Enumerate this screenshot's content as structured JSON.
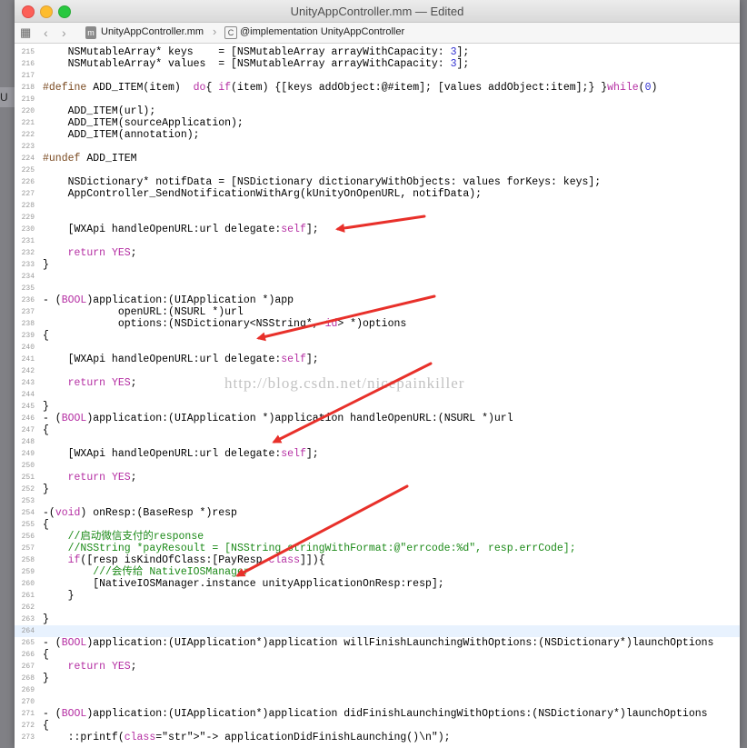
{
  "window": {
    "title": "UnityAppController.mm — Edited"
  },
  "jumpbar": {
    "file_icon_label": "m",
    "file": "UnityAppController.mm",
    "class_icon_label": "C",
    "implementation": "@implementation UnityAppController"
  },
  "background_app_label": "U",
  "watermark": "http://blog.csdn.net/nicepainkiller",
  "lines": [
    {
      "n": "215",
      "t": "    NSMutableArray* keys    = [NSMutableArray arrayWithCapacity: 3];"
    },
    {
      "n": "216",
      "t": "    NSMutableArray* values  = [NSMutableArray arrayWithCapacity: 3];"
    },
    {
      "n": "217",
      "t": ""
    },
    {
      "n": "218",
      "t": "#define ADD_ITEM(item)  do{ if(item) {[keys addObject:@#item]; [values addObject:item];} }while(0)"
    },
    {
      "n": "219",
      "t": ""
    },
    {
      "n": "220",
      "t": "    ADD_ITEM(url);"
    },
    {
      "n": "221",
      "t": "    ADD_ITEM(sourceApplication);"
    },
    {
      "n": "222",
      "t": "    ADD_ITEM(annotation);"
    },
    {
      "n": "223",
      "t": ""
    },
    {
      "n": "224",
      "t": "#undef ADD_ITEM"
    },
    {
      "n": "225",
      "t": ""
    },
    {
      "n": "226",
      "t": "    NSDictionary* notifData = [NSDictionary dictionaryWithObjects: values forKeys: keys];"
    },
    {
      "n": "227",
      "t": "    AppController_SendNotificationWithArg(kUnityOnOpenURL, notifData);"
    },
    {
      "n": "228",
      "t": ""
    },
    {
      "n": "229",
      "t": ""
    },
    {
      "n": "230",
      "t": "    [WXApi handleOpenURL:url delegate:self];"
    },
    {
      "n": "231",
      "t": ""
    },
    {
      "n": "232",
      "t": "    return YES;"
    },
    {
      "n": "233",
      "t": "}"
    },
    {
      "n": "234",
      "t": ""
    },
    {
      "n": "235",
      "t": ""
    },
    {
      "n": "236",
      "t": "- (BOOL)application:(UIApplication *)app"
    },
    {
      "n": "237",
      "t": "            openURL:(NSURL *)url"
    },
    {
      "n": "238",
      "t": "            options:(NSDictionary<NSString*, id> *)options"
    },
    {
      "n": "239",
      "t": "{"
    },
    {
      "n": "240",
      "t": ""
    },
    {
      "n": "241",
      "t": "    [WXApi handleOpenURL:url delegate:self];"
    },
    {
      "n": "242",
      "t": ""
    },
    {
      "n": "243",
      "t": "    return YES;"
    },
    {
      "n": "244",
      "t": ""
    },
    {
      "n": "245",
      "t": "}"
    },
    {
      "n": "246",
      "t": "- (BOOL)application:(UIApplication *)application handleOpenURL:(NSURL *)url"
    },
    {
      "n": "247",
      "t": "{"
    },
    {
      "n": "248",
      "t": ""
    },
    {
      "n": "249",
      "t": "    [WXApi handleOpenURL:url delegate:self];"
    },
    {
      "n": "250",
      "t": ""
    },
    {
      "n": "251",
      "t": "    return YES;"
    },
    {
      "n": "252",
      "t": "}"
    },
    {
      "n": "253",
      "t": ""
    },
    {
      "n": "254",
      "t": "-(void) onResp:(BaseResp *)resp"
    },
    {
      "n": "255",
      "t": "{"
    },
    {
      "n": "256",
      "t": "    //启动微信支付的response"
    },
    {
      "n": "257",
      "t": "    //NSString *payResoult = [NSString stringWithFormat:@\"errcode:%d\", resp.errCode];"
    },
    {
      "n": "258",
      "t": "    if([resp isKindOfClass:[PayResp class]]){"
    },
    {
      "n": "259",
      "t": "        ///会传给 NativeIOSManager"
    },
    {
      "n": "260",
      "t": "        [NativeIOSManager.instance unityApplicationOnResp:resp];"
    },
    {
      "n": "261",
      "t": "    }"
    },
    {
      "n": "262",
      "t": ""
    },
    {
      "n": "263",
      "t": "}"
    },
    {
      "n": "264",
      "t": ""
    },
    {
      "n": "265",
      "t": "- (BOOL)application:(UIApplication*)application willFinishLaunchingWithOptions:(NSDictionary*)launchOptions"
    },
    {
      "n": "266",
      "t": "{"
    },
    {
      "n": "267",
      "t": "    return YES;"
    },
    {
      "n": "268",
      "t": "}"
    },
    {
      "n": "269",
      "t": ""
    },
    {
      "n": "270",
      "t": ""
    },
    {
      "n": "271",
      "t": "- (BOOL)application:(UIApplication*)application didFinishLaunchingWithOptions:(NSDictionary*)launchOptions"
    },
    {
      "n": "272",
      "t": "{"
    },
    {
      "n": "273",
      "t": "    ::printf(\"-> applicationDidFinishLaunching()\\n\");"
    }
  ],
  "highlighted_line": "264",
  "colors": {
    "keyword": "#b52fa3",
    "number": "#2f2fd0",
    "comment": "#1c8a18",
    "string": "#c41a16",
    "arrow": "#e8302a"
  }
}
